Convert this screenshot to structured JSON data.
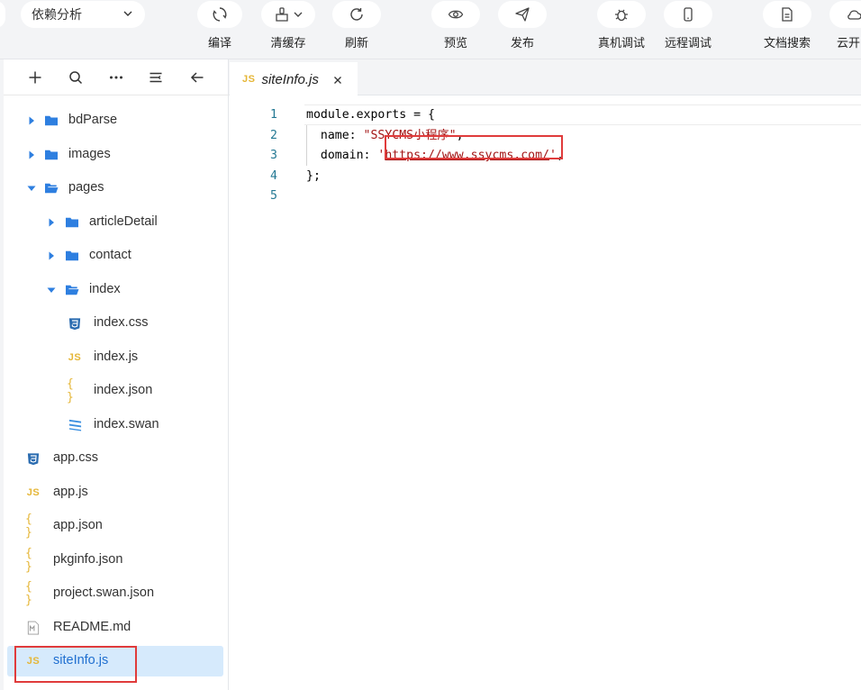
{
  "toolbar": {
    "mode_select": "依赖分析",
    "buttons": [
      {
        "label": "编译",
        "icon": "compile-icon"
      },
      {
        "label": "清缓存",
        "icon": "broom-icon"
      },
      {
        "label": "刷新",
        "icon": "refresh-icon"
      },
      {
        "label": "预览",
        "icon": "eye-icon"
      },
      {
        "label": "发布",
        "icon": "send-icon"
      },
      {
        "label": "真机调试",
        "icon": "bug-icon"
      },
      {
        "label": "远程调试",
        "icon": "phone-icon"
      },
      {
        "label": "文档搜索",
        "icon": "document-icon"
      },
      {
        "label": "云开",
        "icon": "cloud-icon"
      }
    ]
  },
  "sidebar": {
    "tree": [
      {
        "name": "bdParse",
        "type": "folder",
        "expanded": false,
        "depth": 0
      },
      {
        "name": "images",
        "type": "folder",
        "expanded": false,
        "depth": 0
      },
      {
        "name": "pages",
        "type": "folder",
        "expanded": true,
        "depth": 0
      },
      {
        "name": "articleDetail",
        "type": "folder",
        "expanded": false,
        "depth": 1
      },
      {
        "name": "contact",
        "type": "folder",
        "expanded": false,
        "depth": 1
      },
      {
        "name": "index",
        "type": "folder",
        "expanded": true,
        "depth": 1
      },
      {
        "name": "index.css",
        "type": "css",
        "depth": 2
      },
      {
        "name": "index.js",
        "type": "js",
        "depth": 2
      },
      {
        "name": "index.json",
        "type": "json",
        "depth": 2
      },
      {
        "name": "index.swan",
        "type": "swan",
        "depth": 2
      },
      {
        "name": "app.css",
        "type": "css",
        "depth": -1
      },
      {
        "name": "app.js",
        "type": "js",
        "depth": -1
      },
      {
        "name": "app.json",
        "type": "json",
        "depth": -1
      },
      {
        "name": "pkginfo.json",
        "type": "json",
        "depth": -1
      },
      {
        "name": "project.swan.json",
        "type": "json",
        "depth": -1
      },
      {
        "name": "README.md",
        "type": "md",
        "depth": -1
      },
      {
        "name": "siteInfo.js",
        "type": "js",
        "depth": -1,
        "selected": true
      }
    ]
  },
  "editor": {
    "tab": {
      "badge": "JS",
      "name": "siteInfo.js"
    },
    "lines": [
      {
        "num": "1",
        "parts": [
          {
            "t": "module.exports = {",
            "c": "plain"
          }
        ]
      },
      {
        "num": "2",
        "parts": [
          {
            "t": "  name: ",
            "c": "plain"
          },
          {
            "t": "\"SSYCMS小程序\"",
            "c": "str"
          },
          {
            "t": ",",
            "c": "plain"
          }
        ]
      },
      {
        "num": "3",
        "parts": [
          {
            "t": "  domain: ",
            "c": "plain"
          },
          {
            "t": "'",
            "c": "str"
          },
          {
            "t": "https://www.ssycms.com/",
            "c": "url"
          },
          {
            "t": "'",
            "c": "str"
          },
          {
            "t": ",",
            "c": "plain"
          }
        ]
      },
      {
        "num": "4",
        "parts": [
          {
            "t": "};",
            "c": "plain"
          }
        ]
      },
      {
        "num": "5",
        "parts": []
      }
    ]
  },
  "colors": {
    "accent": "#3a7bd5",
    "selection": "#d6eafc",
    "highlight_box": "#e03b3b",
    "folder": "#2e7fe0"
  }
}
